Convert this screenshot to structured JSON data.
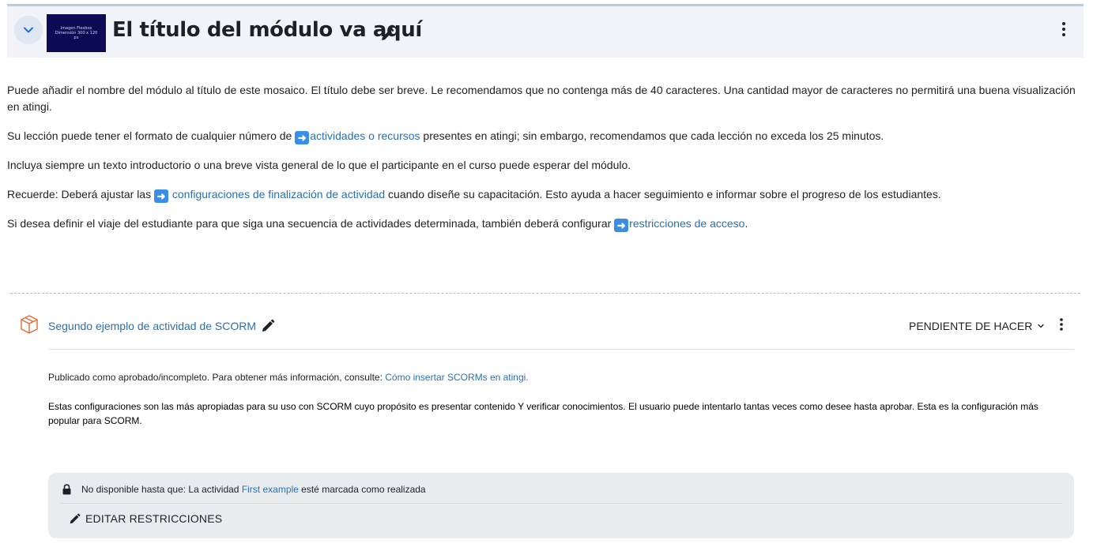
{
  "module": {
    "title": "El título del módulo va aquí",
    "thumbnail_text": "Imagen Flexbox Dimensión 300 x 120 px"
  },
  "summary": {
    "p1": "Puede añadir el nombre del módulo al título de este mosaico.  El título debe ser breve. Le recomendamos que no contenga más de 40 caracteres. Una cantidad mayor de caracteres no permitirá una buena visualización en atingi.",
    "p2_before": "Su lección puede tener el formato de cualquier número de ",
    "p2_link": "actividades o recursos",
    "p2_after": " presentes en atingi; sin embargo, recomendamos que cada lección no exceda los 25 minutos.",
    "p3": "Incluya siempre un texto introductorio o una breve vista general de lo que el participante en el curso puede esperar del módulo.",
    "p4_before": "Recuerde: Deberá ajustar las ",
    "p4_link": " configuraciones de finalización de actividad",
    "p4_after": " cuando diseñe su capacitación. Esto ayuda a hacer seguimiento e informar sobre el progreso de los estudiantes.",
    "p5_before": "Si desea definir el viaje del estudiante para que siga una secuencia de actividades determinada, también deberá configurar ",
    "p5_link": "restricciones de acceso",
    "p5_after": ".",
    "arrow_glyph": "➜"
  },
  "activity": {
    "title": "Segundo ejemplo de actividad de SCORM",
    "completion_status": "PENDIENTE DE HACER",
    "desc1_before": "Publicado como aprobado/incompleto. Para obtener más información, consulte: ",
    "desc1_link": "Cómo insertar SCORMs en atingi.",
    "desc2": "Estas configuraciones son las más apropiadas para su uso con SCORM cuyo propósito es presentar contenido Y verificar conocimientos. El usuario puede intentarlo tantas veces como desee hasta aprobar. Esta es la configuración más popular para SCORM."
  },
  "restrictions": {
    "text_before": "No disponible hasta que: La actividad ",
    "link": "First example",
    "text_after": " esté marcada como realizada",
    "edit_label": "EDITAR RESTRICCIONES"
  },
  "colors": {
    "link": "#2a6fb3",
    "activity_icon": "#e06b35",
    "header_bg": "#f2f3f9"
  }
}
